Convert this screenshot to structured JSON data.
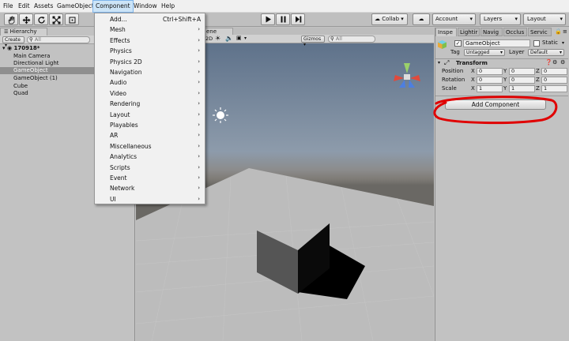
{
  "menubar": [
    "File",
    "Edit",
    "Assets",
    "GameObject",
    "Component",
    "Window",
    "Help"
  ],
  "toolbar": {
    "play_controls": [
      "play-icon",
      "pause-icon",
      "step-icon"
    ],
    "collab_label": "Collab",
    "account_label": "Account",
    "layers_label": "Layers",
    "layout_label": "Layout"
  },
  "hierarchy": {
    "tab_label": "Hierarchy",
    "create_label": "Create",
    "search_placeholder": "All",
    "scene_name": "170918*",
    "items": [
      "Main Camera",
      "Directional Light",
      "GameObject",
      "GameObject (1)",
      "Cube",
      "Quad"
    ],
    "selected": "GameObject"
  },
  "scene_view": {
    "tab_label": "ene",
    "mode_label": "2D",
    "gizmos_label": "Gizmos",
    "search_placeholder": "All"
  },
  "component_menu": {
    "items": [
      {
        "label": "Add...",
        "shortcut": "Ctrl+Shift+A",
        "submenu": false
      },
      {
        "label": "Mesh",
        "submenu": true
      },
      {
        "label": "Effects",
        "submenu": true
      },
      {
        "label": "Physics",
        "submenu": true
      },
      {
        "label": "Physics 2D",
        "submenu": true
      },
      {
        "label": "Navigation",
        "submenu": true
      },
      {
        "label": "Audio",
        "submenu": true
      },
      {
        "label": "Video",
        "submenu": true
      },
      {
        "label": "Rendering",
        "submenu": true
      },
      {
        "label": "Layout",
        "submenu": true
      },
      {
        "label": "Playables",
        "submenu": true
      },
      {
        "label": "AR",
        "submenu": true
      },
      {
        "label": "Miscellaneous",
        "submenu": true
      },
      {
        "label": "Analytics",
        "submenu": true
      },
      {
        "label": "Scripts",
        "submenu": true
      },
      {
        "label": "Event",
        "submenu": true
      },
      {
        "label": "Network",
        "submenu": true
      },
      {
        "label": "UI",
        "submenu": true
      }
    ]
  },
  "inspector": {
    "tabs": [
      "Inspe",
      "Lightir",
      "Navig",
      "Occlus",
      "Servic"
    ],
    "object_name": "GameObject",
    "static_label": "Static",
    "tag_label": "Tag",
    "tag_value": "Untagged",
    "layer_label": "Layer",
    "layer_value": "Default",
    "transform": {
      "title": "Transform",
      "rows": [
        {
          "label": "Position",
          "x": "0",
          "y": "0",
          "z": "0"
        },
        {
          "label": "Rotation",
          "x": "0",
          "y": "0",
          "z": "0"
        },
        {
          "label": "Scale",
          "x": "1",
          "y": "1",
          "z": "1"
        }
      ]
    },
    "add_component_label": "Add Component",
    "highlight_color": "#e00000"
  }
}
